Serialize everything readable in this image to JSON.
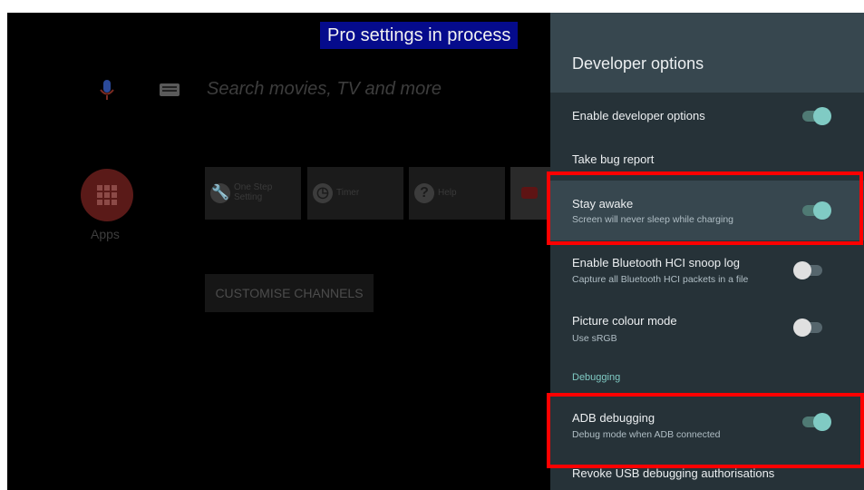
{
  "overlay": {
    "banner": "Pro settings in process"
  },
  "home": {
    "search_placeholder": "Search movies, TV and more",
    "apps_label": "Apps",
    "tiles": [
      {
        "label": "One Step\nSetting",
        "icon": "wrench-icon"
      },
      {
        "label": "Timer",
        "icon": "clock-icon"
      },
      {
        "label": "Help",
        "icon": "question-icon"
      }
    ],
    "customise_button": "CUSTOMISE CHANNELS"
  },
  "panel": {
    "title": "Developer options",
    "rows": [
      {
        "title": "Enable developer options",
        "toggle": "on"
      },
      {
        "title": "Take bug report"
      },
      {
        "title": "Stay awake",
        "subtitle": "Screen will never sleep while charging",
        "toggle": "on",
        "focused": true
      },
      {
        "title": "Enable Bluetooth HCI snoop log",
        "subtitle": "Capture all Bluetooth HCI packets in a file",
        "toggle": "off"
      },
      {
        "title": "Picture colour mode",
        "subtitle": "Use sRGB",
        "toggle": "off"
      },
      {
        "title": "ADB debugging",
        "subtitle": "Debug mode when ADB connected",
        "toggle": "on"
      },
      {
        "title": "Revoke USB debugging authorisations"
      }
    ],
    "section_debugging": "Debugging"
  },
  "colors": {
    "panel_bg": "#263238",
    "panel_header": "#37474f",
    "accent": "#80cbc4",
    "highlight": "#ff0000",
    "banner_bg": "#050b8c"
  }
}
